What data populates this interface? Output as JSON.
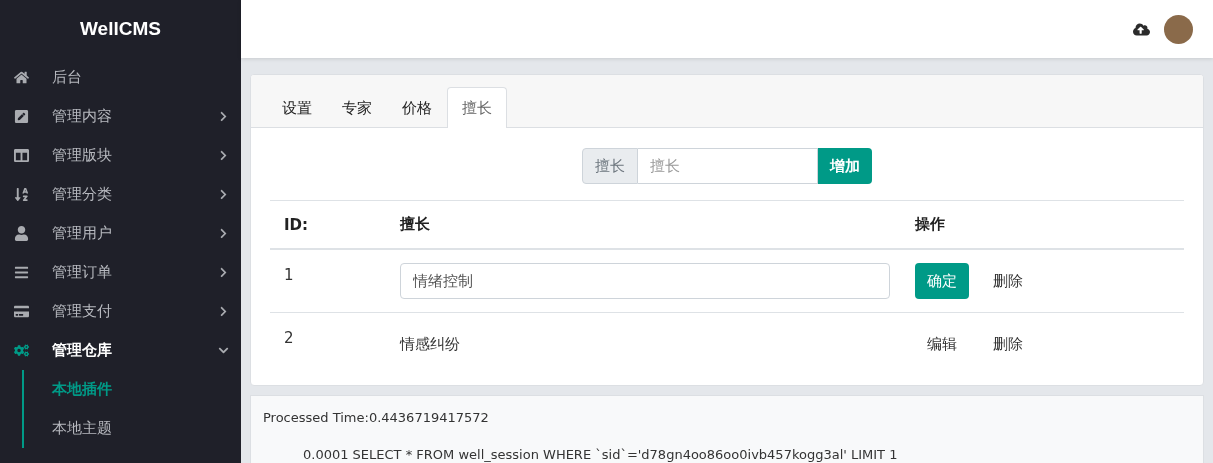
{
  "brand": "WellCMS",
  "nav": [
    {
      "label": "后台",
      "kind": "home"
    },
    {
      "label": "管理内容",
      "kind": "edit",
      "expanded": false
    },
    {
      "label": "管理版块",
      "kind": "columns",
      "expanded": false
    },
    {
      "label": "管理分类",
      "kind": "sort",
      "expanded": false
    },
    {
      "label": "管理用户",
      "kind": "user",
      "expanded": false
    },
    {
      "label": "管理订单",
      "kind": "list",
      "expanded": false
    },
    {
      "label": "管理支付",
      "kind": "card",
      "expanded": false
    },
    {
      "label": "管理仓库",
      "kind": "cogs",
      "expanded": true,
      "children": [
        {
          "label": "本地插件",
          "selected": true
        },
        {
          "label": "本地主题",
          "selected": false
        }
      ]
    }
  ],
  "tabs": [
    {
      "label": "设置",
      "selected": false
    },
    {
      "label": "专家",
      "selected": false
    },
    {
      "label": "价格",
      "selected": false
    },
    {
      "label": "擅长",
      "selected": true
    }
  ],
  "add_form": {
    "addon": "擅长",
    "placeholder": "擅长",
    "button": "增加"
  },
  "table": {
    "columns": [
      "ID:",
      "擅长",
      "操作"
    ],
    "rows": [
      {
        "id": "1",
        "kind": "editing",
        "value": "情绪控制",
        "actions": [
          "确定",
          "删除"
        ]
      },
      {
        "id": "2",
        "kind": "view",
        "value": "情感纠纷",
        "actions": [
          "编辑",
          "删除"
        ]
      }
    ]
  },
  "debug": {
    "time": "Processed Time:0.4436719417572",
    "queries": [
      "0.0001 SELECT * FROM well_session WHERE `sid`='d78gn4oo86oo0ivb457kogg3al' LIMIT 1"
    ]
  }
}
